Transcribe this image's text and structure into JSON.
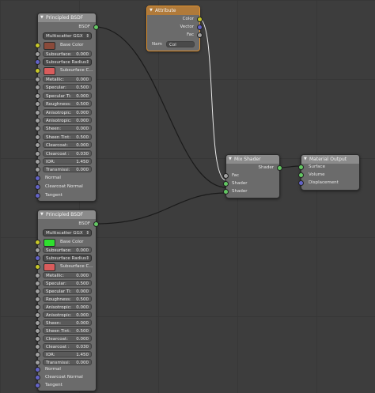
{
  "colors": {
    "base_color_top": "#8a4a3a",
    "subsurface_color": "#d95c5c",
    "base_color_bottom": "#2fe02f",
    "subsurface_color_bottom": "#d95c5c"
  },
  "bsdf_top": {
    "title": "Principled BSDF",
    "output": "BSDF",
    "distribution": "Multiscatter GGX",
    "base_color_label": "Base Color",
    "subsurface": "Subsurface:",
    "subsurface_value": "0.000",
    "subsurface_radius": "Subsurface Radius",
    "subsurface_color": "Subsurface C...",
    "params": [
      {
        "label": "Metallic:",
        "value": "0.000"
      },
      {
        "label": "Specular:",
        "value": "0.500"
      },
      {
        "label": "Specular Ti:",
        "value": "0.000"
      },
      {
        "label": "Roughness:",
        "value": "0.500"
      },
      {
        "label": "Anisotropic:",
        "value": "0.000"
      },
      {
        "label": "Anisotropic:",
        "value": "0.000"
      },
      {
        "label": "Sheen:",
        "value": "0.000"
      },
      {
        "label": "Sheen Tint:",
        "value": "0.500"
      },
      {
        "label": "Clearcoat:",
        "value": "0.000"
      },
      {
        "label": "Clearcoat :",
        "value": "0.030"
      },
      {
        "label": "IOR:",
        "value": "1.450"
      },
      {
        "label": "Transmissi:",
        "value": "0.000"
      }
    ],
    "normal": "Normal",
    "clearcoat_normal": "Clearcoat Normal",
    "tangent": "Tangent"
  },
  "bsdf_bottom": {
    "title": "Principled BSDF",
    "output": "BSDF",
    "distribution": "Multiscatter GGX",
    "base_color_label": "Base Color",
    "subsurface": "Subsurface:",
    "subsurface_value": "0.000",
    "subsurface_radius": "Subsurface Radius",
    "subsurface_color": "Subsurface C...",
    "params": [
      {
        "label": "Metallic:",
        "value": "0.000"
      },
      {
        "label": "Specular:",
        "value": "0.500"
      },
      {
        "label": "Specular Ti:",
        "value": "0.000"
      },
      {
        "label": "Roughness:",
        "value": "0.500"
      },
      {
        "label": "Anisotropic:",
        "value": "0.000"
      },
      {
        "label": "Anisotropic:",
        "value": "0.000"
      },
      {
        "label": "Sheen:",
        "value": "0.000"
      },
      {
        "label": "Sheen Tint:",
        "value": "0.500"
      },
      {
        "label": "Clearcoat:",
        "value": "0.000"
      },
      {
        "label": "Clearcoat :",
        "value": "0.030"
      },
      {
        "label": "IOR:",
        "value": "1.450"
      },
      {
        "label": "Transmissi:",
        "value": "0.000"
      }
    ],
    "normal": "Normal",
    "clearcoat_normal": "Clearcoat Normal",
    "tangent": "Tangent"
  },
  "attribute": {
    "title": "Attribute",
    "color": "Color",
    "vector": "Vector",
    "fac": "Fac",
    "name_label": "Nam",
    "name_value": "Col"
  },
  "mix_shader": {
    "title": "Mix Shader",
    "output": "Shader",
    "fac": "Fac",
    "shader1": "Shader",
    "shader2": "Shader"
  },
  "material_output": {
    "title": "Material Output",
    "surface": "Surface",
    "volume": "Volume",
    "displacement": "Displacement"
  }
}
